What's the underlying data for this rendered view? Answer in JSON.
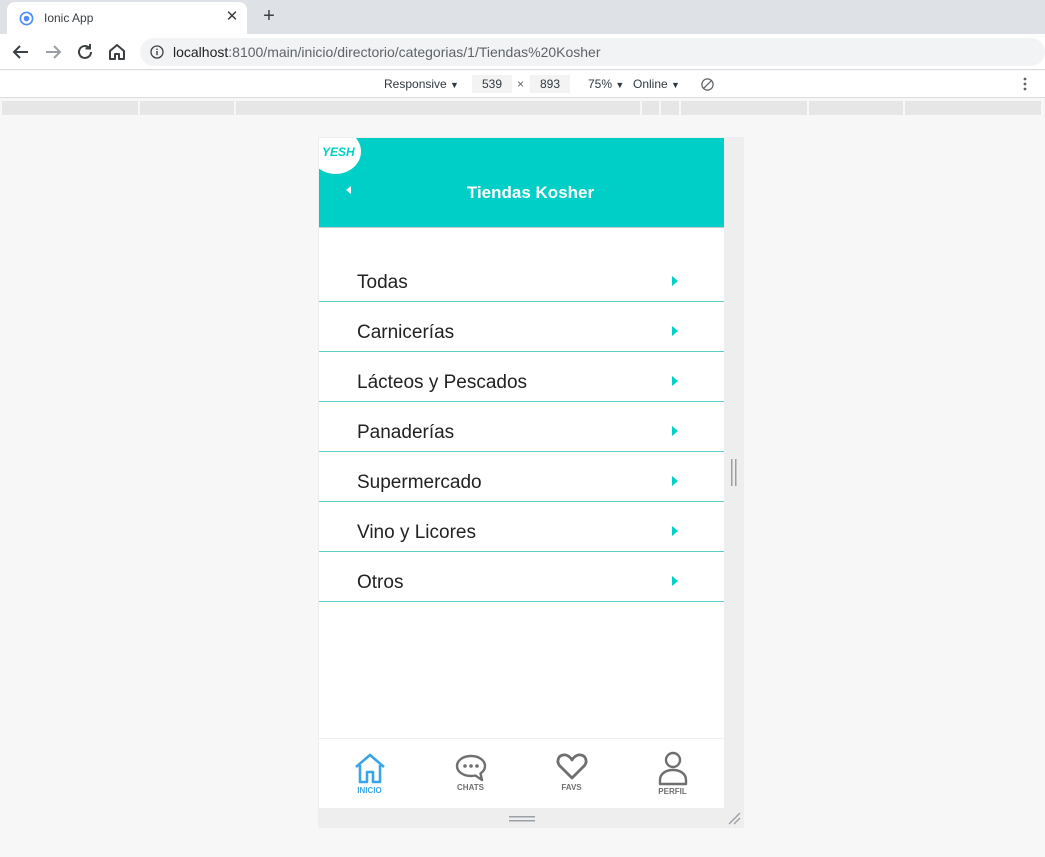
{
  "browser": {
    "tab_title": "Ionic App",
    "tab_close": "✕",
    "new_tab": "+",
    "url_host": "localhost",
    "url_path": ":8100/main/inicio/directorio/categorias/1/Tiendas%20Kosher"
  },
  "devtools": {
    "device_mode": "Responsive",
    "width": "539",
    "times": "×",
    "height": "893",
    "zoom": "75%",
    "network": "Online"
  },
  "app": {
    "logo_text": "YESH",
    "title": "Tiendas Kosher",
    "accent_color": "#00cfc8",
    "categories": [
      {
        "label": "Todas"
      },
      {
        "label": "Carnicerías"
      },
      {
        "label": "Lácteos y Pescados"
      },
      {
        "label": "Panaderías"
      },
      {
        "label": "Supermercado"
      },
      {
        "label": "Vino y Licores"
      },
      {
        "label": "Otros"
      }
    ],
    "tabs": [
      {
        "label": "INICIO",
        "icon": "home-icon",
        "active": true
      },
      {
        "label": "CHATS",
        "icon": "chat-icon",
        "active": false
      },
      {
        "label": "FAVS",
        "icon": "heart-icon",
        "active": false
      },
      {
        "label": "PERFIL",
        "icon": "person-icon",
        "active": false
      }
    ]
  }
}
